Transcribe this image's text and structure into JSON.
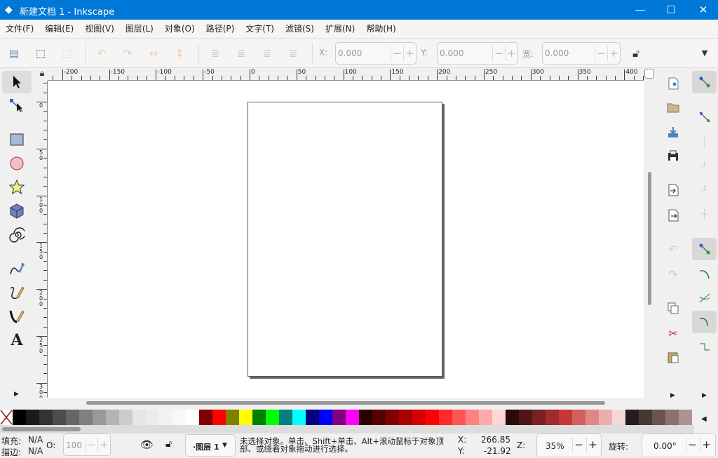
{
  "window": {
    "title": "新建文档 1 - Inkscape",
    "minimize": "—",
    "maximize": "☐",
    "close": "✕"
  },
  "menu": [
    "文件(F)",
    "编辑(E)",
    "视图(V)",
    "图层(L)",
    "对象(O)",
    "路径(P)",
    "文字(T)",
    "滤镜(S)",
    "扩展(N)",
    "帮助(H)"
  ],
  "toolbar": {
    "x_label": "X:",
    "x_value": "0.000",
    "y_label": "Y:",
    "y_value": "0.000",
    "w_label": "宽:",
    "w_value": "0.000",
    "minus": "−",
    "plus": "+"
  },
  "rulers": {
    "h_labels": [
      "-200",
      "-150",
      "-100",
      "-50",
      "0",
      "50",
      "100",
      "150",
      "200",
      "250",
      "300",
      "350",
      "400"
    ],
    "v_labels": [
      "0",
      "50",
      "100",
      "150",
      "200",
      "250",
      "300"
    ]
  },
  "palette": [
    "#000000",
    "#1a1a1a",
    "#333333",
    "#4d4d4d",
    "#666666",
    "#808080",
    "#999999",
    "#b3b3b3",
    "#cccccc",
    "#e6e6e6",
    "#ececec",
    "#f2f2f2",
    "#f8f8f8",
    "#ffffff",
    "#800000",
    "#ff0000",
    "#808000",
    "#ffff00",
    "#008000",
    "#00ff00",
    "#008080",
    "#00ffff",
    "#000080",
    "#0000ff",
    "#800080",
    "#ff00ff",
    "#2b0000",
    "#550000",
    "#800000",
    "#aa0000",
    "#d40000",
    "#ff0000",
    "#ff2a2a",
    "#ff5555",
    "#ff8080",
    "#ffaaaa",
    "#ffd5d5",
    "#280b0b",
    "#501616",
    "#782121",
    "#a02c2c",
    "#c83737",
    "#d35f5f",
    "#de8787",
    "#e9afaf",
    "#f4d7d7",
    "#241c1c",
    "#483737",
    "#6c5353",
    "#916f6f",
    "#ac9393"
  ],
  "status": {
    "fill_label": "填充:",
    "fill_value": "N/A",
    "stroke_label": "描边:",
    "stroke_value": "N/A",
    "opacity_label": "O:",
    "opacity_value": "100",
    "layer": "·图层 1",
    "message_line1": "未选择对象。单击、Shift+单击、Alt+滚动鼠标于对象顶",
    "message_line2": "部、或绕着对象拖动进行选择。",
    "x_label": "X:",
    "x_value": "266.85",
    "y_label": "Y:",
    "y_value": "-21.92",
    "zoom_label": "Z:",
    "zoom_value": "35%",
    "rotate_label": "旋转:",
    "rotate_value": "0.00°",
    "minus": "−",
    "plus": "+"
  }
}
